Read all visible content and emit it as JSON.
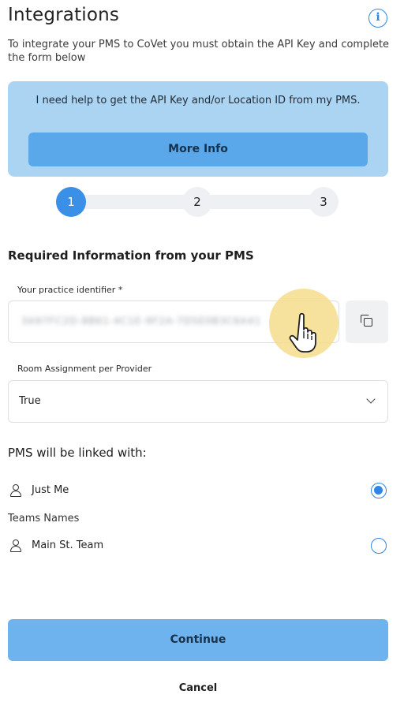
{
  "header": {
    "title": "Integrations",
    "info_icon": "info-icon",
    "subtitle": "To integrate your PMS to CoVet you must obtain the API Key and complete the form below"
  },
  "help": {
    "text": "I need help to get the API Key and/or Location ID from my PMS.",
    "more_info_label": "More Info"
  },
  "stepper": {
    "steps": [
      "1",
      "2",
      "3"
    ],
    "active_step": 1
  },
  "form": {
    "section_title": "Required Information from your PMS",
    "practice_identifier": {
      "label": "Your practice identifier *",
      "value": "3A97FC2D-8B61-4C1E-9F2A-7D5E0B3C6A41",
      "copy_icon": "copy-icon"
    },
    "room_assignment": {
      "label": "Room Assignment per Provider",
      "selected": "True"
    }
  },
  "linked": {
    "title": "PMS will be linked with:",
    "options": [
      {
        "label": "Just Me",
        "selected": true,
        "icon": "person-icon"
      }
    ],
    "teams_label": "Teams Names",
    "teams": [
      {
        "label": "Main St. Team",
        "selected": false,
        "icon": "person-icon"
      }
    ]
  },
  "actions": {
    "continue_label": "Continue",
    "cancel_label": "Cancel"
  },
  "colors": {
    "accent": "#2f87e4",
    "help_bg": "#abd4f3",
    "button_bg": "#5aa7ea",
    "continue_bg": "#6fb3ee"
  }
}
